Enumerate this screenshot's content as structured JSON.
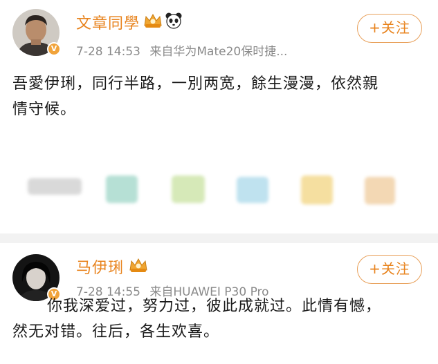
{
  "post1": {
    "username": "文章同學",
    "timestamp": "7-28 14:53",
    "source": "来自华为Mate20保时捷...",
    "follow_label": "+关注",
    "content_line1": "吾愛伊琍，同行半路，一別两宽，餘生漫漫，依然親",
    "content_line2": "情守候。",
    "badges": [
      "crown-badge-icon",
      "panda-icon"
    ]
  },
  "post2": {
    "username": "马伊琍",
    "timestamp": "7-28 14:55",
    "source": "来自HUAWEI P30 Pro",
    "follow_label": "+关注",
    "content_line1": "你我深爱过，努力过，彼此成就过。此情有憾，",
    "content_line2": "然无对错。往后，各生欢喜。",
    "badges": [
      "crown-badge-icon"
    ]
  },
  "colors": {
    "username": "#e8831d",
    "meta": "#8a8a8a",
    "follow_border": "#e8a05a",
    "verified_badge": "#f1a33a",
    "separator": "#f2f2f2"
  },
  "blurred_icons": [
    "blurred-icon-1",
    "blurred-icon-2",
    "blurred-icon-3",
    "blurred-icon-4",
    "blurred-icon-5",
    "blurred-icon-6"
  ]
}
